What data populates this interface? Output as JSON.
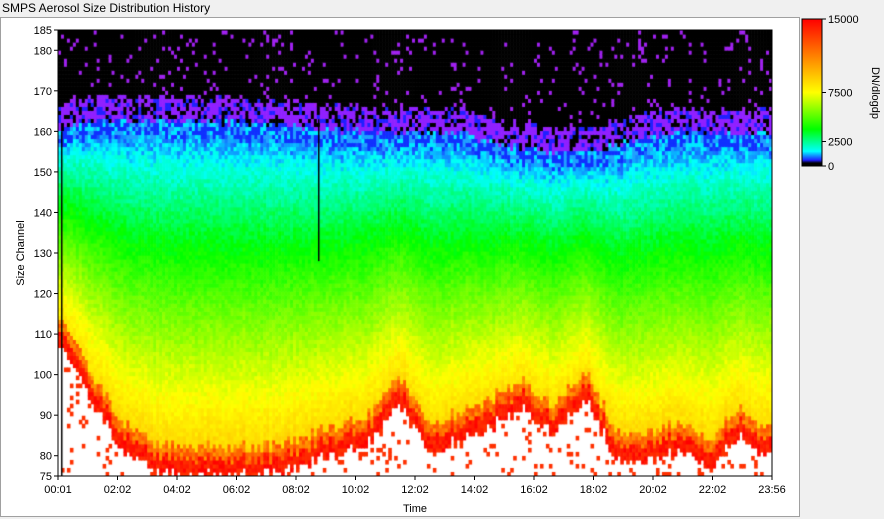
{
  "window": {
    "title": "SMPS Aerosol Size Distribution History"
  },
  "chart_data": {
    "type": "heatmap",
    "title": "SMPS Aerosol Size Distribution History",
    "xlabel": "Time",
    "ylabel": "Size Channel",
    "colorbar_label": "DN/dlogdp",
    "x_ticks": [
      "00:01",
      "02:02",
      "04:02",
      "06:02",
      "08:02",
      "10:02",
      "12:02",
      "14:02",
      "16:02",
      "18:02",
      "20:02",
      "22:02",
      "23:56"
    ],
    "y_ticks": [
      75,
      80,
      90,
      100,
      110,
      120,
      130,
      140,
      150,
      160,
      170,
      180,
      185
    ],
    "xlim_minutes": [
      1,
      1436
    ],
    "ylim": [
      75,
      185
    ],
    "colorbar_ticks": [
      0,
      2500,
      7500,
      15000
    ],
    "colorbar_range": [
      0,
      15000
    ],
    "colorbar_colors": [
      "#000000",
      "#2020ff",
      "#00ffff",
      "#00ff00",
      "#ffff00",
      "#ff8000",
      "#ff0000"
    ],
    "grid": false,
    "description_profile": {
      "upper_edge_channel": [
        160,
        163,
        163,
        163,
        163,
        163,
        162,
        162,
        161,
        161,
        160,
        160,
        160,
        160,
        158,
        156,
        155,
        155,
        157,
        159,
        160,
        160,
        160,
        160
      ],
      "high_conc_lower_edge_channel": [
        108,
        95,
        82,
        77,
        76,
        76,
        76,
        76,
        79,
        81,
        84,
        94,
        81,
        85,
        88,
        92,
        86,
        95,
        80,
        79,
        82,
        78,
        86,
        80
      ]
    }
  }
}
